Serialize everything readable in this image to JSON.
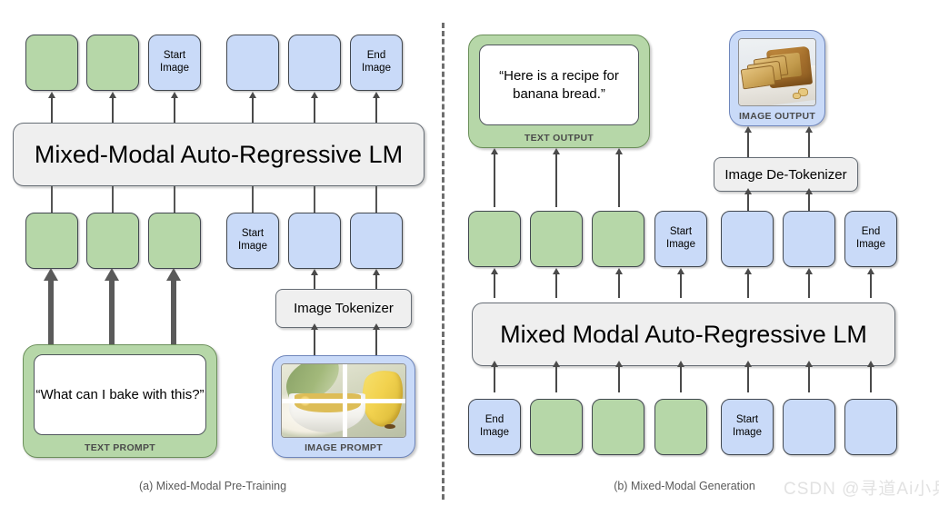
{
  "figure": {
    "panel_a": {
      "caption": "(a) Mixed-Modal Pre-Training",
      "model_label": "Mixed-Modal Auto-Regressive LM",
      "tokenizer_label": "Image Tokenizer",
      "text_prompt": {
        "quote": "“What can I bake with this?”",
        "label": "TEXT PROMPT"
      },
      "image_prompt": {
        "label": "IMAGE PROMPT",
        "alt": "bowl of sliced bananas next to a whole banana, split into a 2x2 patch grid"
      },
      "output_tokens": [
        {
          "type": "green",
          "label": ""
        },
        {
          "type": "green",
          "label": ""
        },
        {
          "type": "blue",
          "label": "Start\nImage"
        },
        {
          "type": "blue",
          "label": ""
        },
        {
          "type": "blue",
          "label": ""
        },
        {
          "type": "blue",
          "label": "End\nImage"
        }
      ],
      "input_tokens": [
        {
          "type": "green",
          "label": ""
        },
        {
          "type": "green",
          "label": ""
        },
        {
          "type": "green",
          "label": ""
        },
        {
          "type": "blue",
          "label": "Start\nImage"
        },
        {
          "type": "blue",
          "label": ""
        },
        {
          "type": "blue",
          "label": ""
        }
      ]
    },
    "panel_b": {
      "caption": "(b) Mixed-Modal Generation",
      "model_label": "Mixed Modal Auto-Regressive LM",
      "detokenizer_label": "Image De-Tokenizer",
      "text_output": {
        "quote": "“Here is a recipe for banana bread.”",
        "label": "TEXT OUTPUT"
      },
      "image_output": {
        "label": "IMAGE OUTPUT",
        "alt": "sliced loaf of banana bread on a cutting board"
      },
      "output_tokens": [
        {
          "type": "green",
          "label": ""
        },
        {
          "type": "green",
          "label": ""
        },
        {
          "type": "green",
          "label": ""
        },
        {
          "type": "blue",
          "label": "Start\nImage"
        },
        {
          "type": "blue",
          "label": ""
        },
        {
          "type": "blue",
          "label": ""
        },
        {
          "type": "blue",
          "label": "End\nImage"
        }
      ],
      "input_tokens": [
        {
          "type": "blue",
          "label": "End\nImage"
        },
        {
          "type": "green",
          "label": ""
        },
        {
          "type": "green",
          "label": ""
        },
        {
          "type": "green",
          "label": ""
        },
        {
          "type": "blue",
          "label": "Start\nImage"
        },
        {
          "type": "blue",
          "label": ""
        },
        {
          "type": "blue",
          "label": ""
        }
      ]
    },
    "watermark": "CSDN @寻道Ai小兵",
    "colors": {
      "text_token": "#b6d7a8",
      "image_token": "#c9daf8",
      "module": "#efefef",
      "arrow": "#4a4a4a",
      "divider": "#6e6e6e",
      "caption": "#5a5a5a"
    }
  }
}
